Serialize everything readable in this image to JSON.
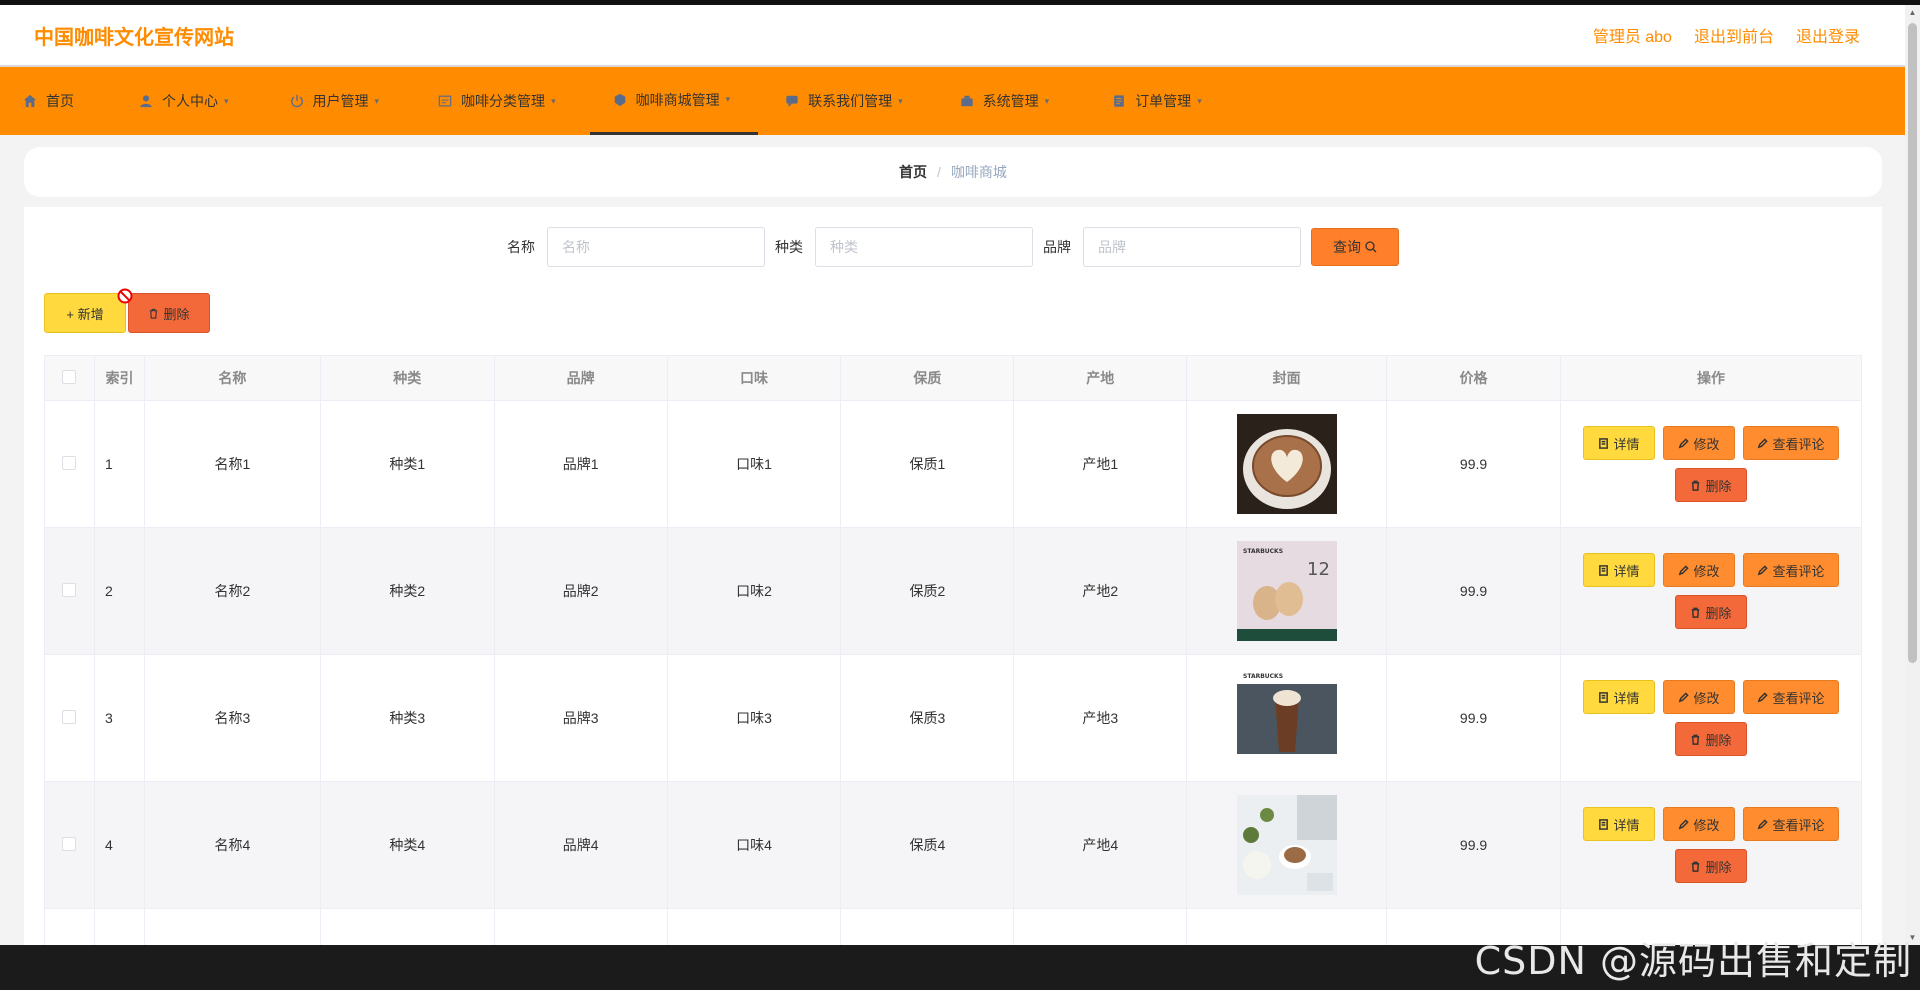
{
  "header": {
    "site_title": "中国咖啡文化宣传网站",
    "admin_label": "管理员 abo",
    "back_front": "退出到前台",
    "logout": "退出登录"
  },
  "nav": {
    "items": [
      {
        "label": "首页",
        "icon": "home-icon",
        "caret": false
      },
      {
        "label": "个人中心",
        "icon": "user-icon",
        "caret": true
      },
      {
        "label": "用户管理",
        "icon": "power-icon",
        "caret": true
      },
      {
        "label": "咖啡分类管理",
        "icon": "folder-icon",
        "caret": true
      },
      {
        "label": "咖啡商城管理",
        "icon": "goods-icon",
        "caret": true,
        "active": true
      },
      {
        "label": "联系我们管理",
        "icon": "chat-icon",
        "caret": true
      },
      {
        "label": "系统管理",
        "icon": "system-icon",
        "caret": true
      },
      {
        "label": "订单管理",
        "icon": "order-icon",
        "caret": true
      }
    ]
  },
  "breadcrumb": {
    "home": "首页",
    "sep": "/",
    "current": "咖啡商城"
  },
  "search": {
    "name_label": "名称",
    "name_placeholder": "名称",
    "category_label": "种类",
    "category_placeholder": "种类",
    "brand_label": "品牌",
    "brand_placeholder": "品牌",
    "query_button": "查询"
  },
  "toolbar": {
    "add": "+ 新增",
    "delete": "删除"
  },
  "table": {
    "headers": [
      "索引",
      "名称",
      "种类",
      "品牌",
      "口味",
      "保质",
      "产地",
      "封面",
      "价格",
      "操作"
    ],
    "rows": [
      {
        "index": "1",
        "name": "名称1",
        "category": "种类1",
        "brand": "品牌1",
        "flavor": "口味1",
        "shelf": "保质1",
        "origin": "产地1",
        "price": "99.9",
        "cover": "latte-art"
      },
      {
        "index": "2",
        "name": "名称2",
        "category": "种类2",
        "brand": "品牌2",
        "flavor": "口味2",
        "shelf": "保质2",
        "origin": "产地2",
        "price": "99.9",
        "cover": "starbucks-cups"
      },
      {
        "index": "3",
        "name": "名称3",
        "category": "种类3",
        "brand": "品牌3",
        "flavor": "口味3",
        "shelf": "保质3",
        "origin": "产地3",
        "price": "99.9",
        "cover": "starbucks-frappe"
      },
      {
        "index": "4",
        "name": "名称4",
        "category": "种类4",
        "brand": "品牌4",
        "flavor": "口味4",
        "shelf": "保质4",
        "origin": "产地4",
        "price": "99.9",
        "cover": "coffee-flowers"
      }
    ],
    "row_buttons": {
      "detail": "详情",
      "edit": "修改",
      "comment": "查看评论",
      "delete": "删除"
    }
  },
  "watermark": "CSDN @源码出售和定制",
  "colors": {
    "accent": "#ff8c00",
    "yellow_btn": "#ffd93d",
    "orange_btn": "#ff8c2e",
    "red_btn": "#f4693a"
  }
}
